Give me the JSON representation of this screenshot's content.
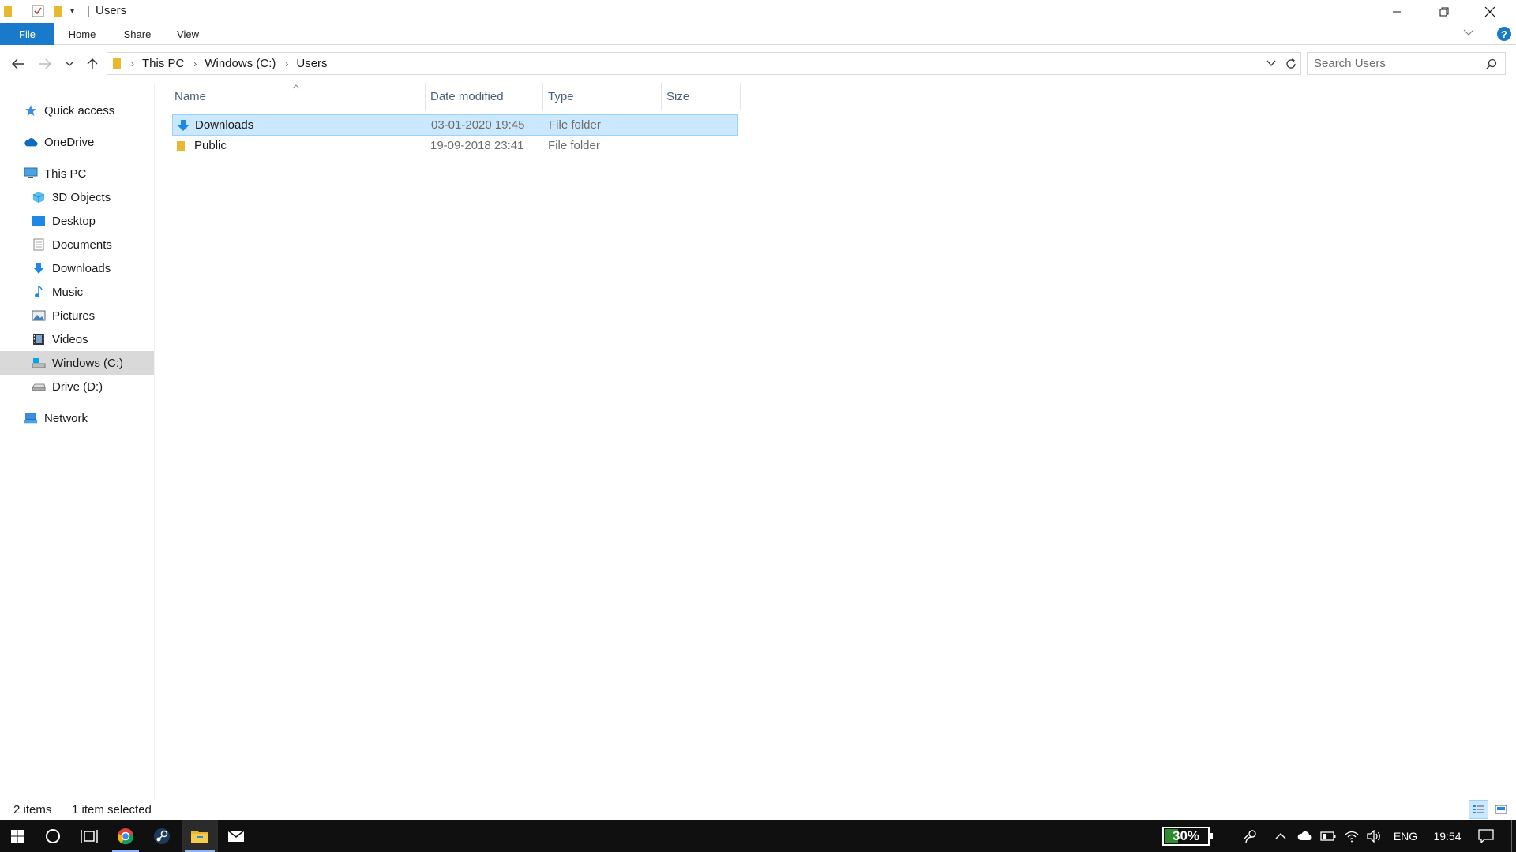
{
  "window": {
    "title": "Users",
    "controls": {
      "minimize": "—",
      "restore": "❐",
      "close": "✕"
    }
  },
  "ribbon": {
    "tabs": [
      {
        "label": "File"
      },
      {
        "label": "Home"
      },
      {
        "label": "Share"
      },
      {
        "label": "View"
      }
    ],
    "help": "?"
  },
  "address": {
    "crumbs": [
      "This PC",
      "Windows (C:)",
      "Users"
    ],
    "search_placeholder": "Search Users"
  },
  "nav": {
    "items": [
      {
        "label": "Quick access",
        "icon": "star-icon"
      },
      {
        "label": "OneDrive",
        "icon": "cloud-icon"
      },
      {
        "label": "This PC",
        "icon": "computer-icon"
      },
      {
        "label": "3D Objects",
        "icon": "cube-icon"
      },
      {
        "label": "Desktop",
        "icon": "desktop-icon"
      },
      {
        "label": "Documents",
        "icon": "document-icon"
      },
      {
        "label": "Downloads",
        "icon": "download-icon"
      },
      {
        "label": "Music",
        "icon": "music-icon"
      },
      {
        "label": "Pictures",
        "icon": "picture-icon"
      },
      {
        "label": "Videos",
        "icon": "video-icon"
      },
      {
        "label": "Windows (C:)",
        "icon": "drive-icon",
        "selected": true
      },
      {
        "label": "Drive (D:)",
        "icon": "drive-icon"
      },
      {
        "label": "Network",
        "icon": "network-icon"
      }
    ]
  },
  "files": {
    "columns": [
      "Name",
      "Date modified",
      "Type",
      "Size"
    ],
    "rows": [
      {
        "name": "Downloads",
        "date": "03-01-2020 19:45",
        "type": "File folder",
        "size": "",
        "selected": true
      },
      {
        "name": "Public",
        "date": "19-09-2018 23:41",
        "type": "File folder",
        "size": "",
        "selected": false
      }
    ]
  },
  "status": {
    "items_count": "2 items",
    "selection": "1 item selected"
  },
  "taskbar": {
    "battery": "30%",
    "language": "ENG",
    "time": "19:54"
  },
  "colors": {
    "accent": "#1979ca",
    "selection": "#cce8ff",
    "folder": "#e8b92f",
    "taskbar": "#101010"
  }
}
